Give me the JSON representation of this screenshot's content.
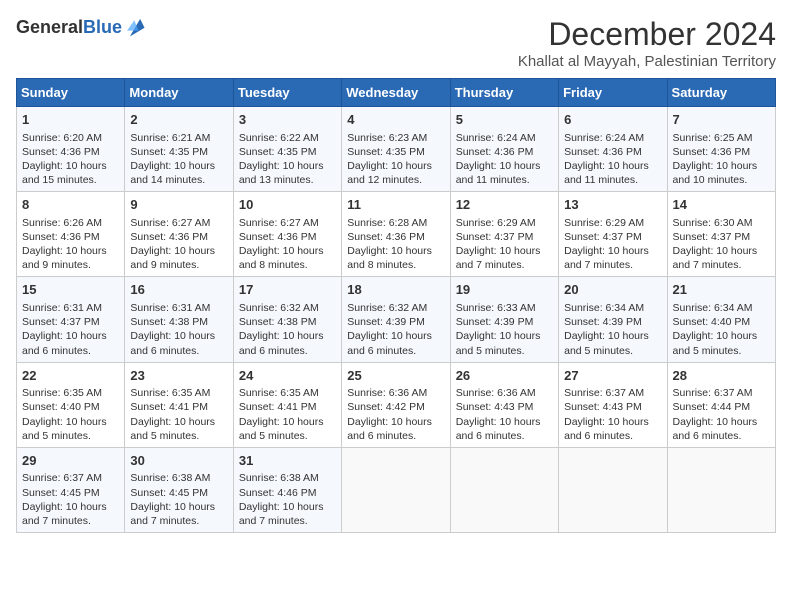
{
  "header": {
    "logo_general": "General",
    "logo_blue": "Blue",
    "month_title": "December 2024",
    "location": "Khallat al Mayyah, Palestinian Territory"
  },
  "days_of_week": [
    "Sunday",
    "Monday",
    "Tuesday",
    "Wednesday",
    "Thursday",
    "Friday",
    "Saturday"
  ],
  "weeks": [
    [
      {
        "day": "1",
        "sunrise": "Sunrise: 6:20 AM",
        "sunset": "Sunset: 4:36 PM",
        "daylight": "Daylight: 10 hours and 15 minutes."
      },
      {
        "day": "2",
        "sunrise": "Sunrise: 6:21 AM",
        "sunset": "Sunset: 4:35 PM",
        "daylight": "Daylight: 10 hours and 14 minutes."
      },
      {
        "day": "3",
        "sunrise": "Sunrise: 6:22 AM",
        "sunset": "Sunset: 4:35 PM",
        "daylight": "Daylight: 10 hours and 13 minutes."
      },
      {
        "day": "4",
        "sunrise": "Sunrise: 6:23 AM",
        "sunset": "Sunset: 4:35 PM",
        "daylight": "Daylight: 10 hours and 12 minutes."
      },
      {
        "day": "5",
        "sunrise": "Sunrise: 6:24 AM",
        "sunset": "Sunset: 4:36 PM",
        "daylight": "Daylight: 10 hours and 11 minutes."
      },
      {
        "day": "6",
        "sunrise": "Sunrise: 6:24 AM",
        "sunset": "Sunset: 4:36 PM",
        "daylight": "Daylight: 10 hours and 11 minutes."
      },
      {
        "day": "7",
        "sunrise": "Sunrise: 6:25 AM",
        "sunset": "Sunset: 4:36 PM",
        "daylight": "Daylight: 10 hours and 10 minutes."
      }
    ],
    [
      {
        "day": "8",
        "sunrise": "Sunrise: 6:26 AM",
        "sunset": "Sunset: 4:36 PM",
        "daylight": "Daylight: 10 hours and 9 minutes."
      },
      {
        "day": "9",
        "sunrise": "Sunrise: 6:27 AM",
        "sunset": "Sunset: 4:36 PM",
        "daylight": "Daylight: 10 hours and 9 minutes."
      },
      {
        "day": "10",
        "sunrise": "Sunrise: 6:27 AM",
        "sunset": "Sunset: 4:36 PM",
        "daylight": "Daylight: 10 hours and 8 minutes."
      },
      {
        "day": "11",
        "sunrise": "Sunrise: 6:28 AM",
        "sunset": "Sunset: 4:36 PM",
        "daylight": "Daylight: 10 hours and 8 minutes."
      },
      {
        "day": "12",
        "sunrise": "Sunrise: 6:29 AM",
        "sunset": "Sunset: 4:37 PM",
        "daylight": "Daylight: 10 hours and 7 minutes."
      },
      {
        "day": "13",
        "sunrise": "Sunrise: 6:29 AM",
        "sunset": "Sunset: 4:37 PM",
        "daylight": "Daylight: 10 hours and 7 minutes."
      },
      {
        "day": "14",
        "sunrise": "Sunrise: 6:30 AM",
        "sunset": "Sunset: 4:37 PM",
        "daylight": "Daylight: 10 hours and 7 minutes."
      }
    ],
    [
      {
        "day": "15",
        "sunrise": "Sunrise: 6:31 AM",
        "sunset": "Sunset: 4:37 PM",
        "daylight": "Daylight: 10 hours and 6 minutes."
      },
      {
        "day": "16",
        "sunrise": "Sunrise: 6:31 AM",
        "sunset": "Sunset: 4:38 PM",
        "daylight": "Daylight: 10 hours and 6 minutes."
      },
      {
        "day": "17",
        "sunrise": "Sunrise: 6:32 AM",
        "sunset": "Sunset: 4:38 PM",
        "daylight": "Daylight: 10 hours and 6 minutes."
      },
      {
        "day": "18",
        "sunrise": "Sunrise: 6:32 AM",
        "sunset": "Sunset: 4:39 PM",
        "daylight": "Daylight: 10 hours and 6 minutes."
      },
      {
        "day": "19",
        "sunrise": "Sunrise: 6:33 AM",
        "sunset": "Sunset: 4:39 PM",
        "daylight": "Daylight: 10 hours and 5 minutes."
      },
      {
        "day": "20",
        "sunrise": "Sunrise: 6:34 AM",
        "sunset": "Sunset: 4:39 PM",
        "daylight": "Daylight: 10 hours and 5 minutes."
      },
      {
        "day": "21",
        "sunrise": "Sunrise: 6:34 AM",
        "sunset": "Sunset: 4:40 PM",
        "daylight": "Daylight: 10 hours and 5 minutes."
      }
    ],
    [
      {
        "day": "22",
        "sunrise": "Sunrise: 6:35 AM",
        "sunset": "Sunset: 4:40 PM",
        "daylight": "Daylight: 10 hours and 5 minutes."
      },
      {
        "day": "23",
        "sunrise": "Sunrise: 6:35 AM",
        "sunset": "Sunset: 4:41 PM",
        "daylight": "Daylight: 10 hours and 5 minutes."
      },
      {
        "day": "24",
        "sunrise": "Sunrise: 6:35 AM",
        "sunset": "Sunset: 4:41 PM",
        "daylight": "Daylight: 10 hours and 5 minutes."
      },
      {
        "day": "25",
        "sunrise": "Sunrise: 6:36 AM",
        "sunset": "Sunset: 4:42 PM",
        "daylight": "Daylight: 10 hours and 6 minutes."
      },
      {
        "day": "26",
        "sunrise": "Sunrise: 6:36 AM",
        "sunset": "Sunset: 4:43 PM",
        "daylight": "Daylight: 10 hours and 6 minutes."
      },
      {
        "day": "27",
        "sunrise": "Sunrise: 6:37 AM",
        "sunset": "Sunset: 4:43 PM",
        "daylight": "Daylight: 10 hours and 6 minutes."
      },
      {
        "day": "28",
        "sunrise": "Sunrise: 6:37 AM",
        "sunset": "Sunset: 4:44 PM",
        "daylight": "Daylight: 10 hours and 6 minutes."
      }
    ],
    [
      {
        "day": "29",
        "sunrise": "Sunrise: 6:37 AM",
        "sunset": "Sunset: 4:45 PM",
        "daylight": "Daylight: 10 hours and 7 minutes."
      },
      {
        "day": "30",
        "sunrise": "Sunrise: 6:38 AM",
        "sunset": "Sunset: 4:45 PM",
        "daylight": "Daylight: 10 hours and 7 minutes."
      },
      {
        "day": "31",
        "sunrise": "Sunrise: 6:38 AM",
        "sunset": "Sunset: 4:46 PM",
        "daylight": "Daylight: 10 hours and 7 minutes."
      },
      null,
      null,
      null,
      null
    ]
  ]
}
